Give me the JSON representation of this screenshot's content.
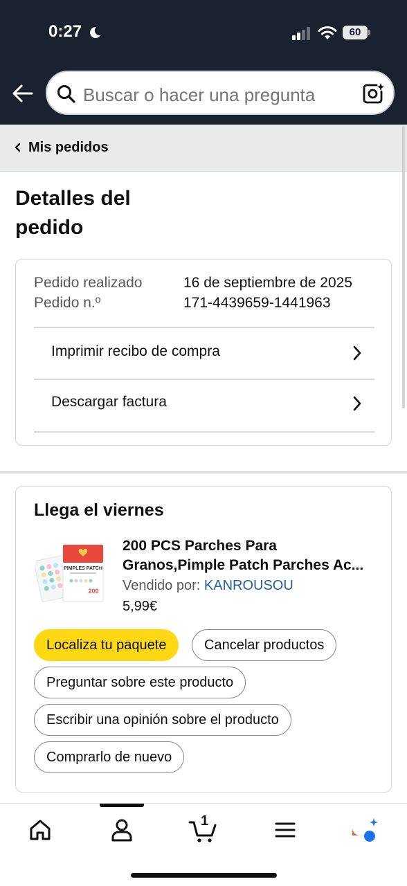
{
  "status_bar": {
    "time": "0:27",
    "battery": "60"
  },
  "search": {
    "placeholder": "Buscar o hacer una pregunta"
  },
  "breadcrumb": {
    "label": "Mis pedidos"
  },
  "page": {
    "title": "Detalles del pedido"
  },
  "order_summary": {
    "placed_label": "Pedido realizado",
    "placed_value": "16 de septiembre de 2025",
    "number_label": "Pedido n.º",
    "number_value": "171-4439659-1441963",
    "actions": [
      {
        "label": "Imprimir recibo de compra"
      },
      {
        "label": "Descargar factura"
      }
    ]
  },
  "delivery": {
    "title": "Llega el viernes",
    "product": {
      "title_line1": "200 PCS Parches Para",
      "title_line2": "Granos,Pimple Patch Parches Ac...",
      "image_text": "PIMPLES PATCH",
      "image_count": "200",
      "sold_by_label": "Vendido por:",
      "seller": "KANROUSOU",
      "price": "5,99€"
    },
    "buttons": {
      "track": "Localiza tu paquete",
      "cancel": "Cancelar productos",
      "ask": "Preguntar sobre este producto",
      "review": "Escribir una opinión sobre el producto",
      "buy_again": "Comprarlo de nuevo"
    }
  },
  "bottom_nav": {
    "cart_count": "1",
    "items": [
      "home-icon",
      "account-icon",
      "cart-icon",
      "menu-icon",
      "rufus-ai-icon"
    ]
  },
  "colors": {
    "header_bg": "#1a2230",
    "primary_button": "#ffd814",
    "link": "#2162a1"
  }
}
